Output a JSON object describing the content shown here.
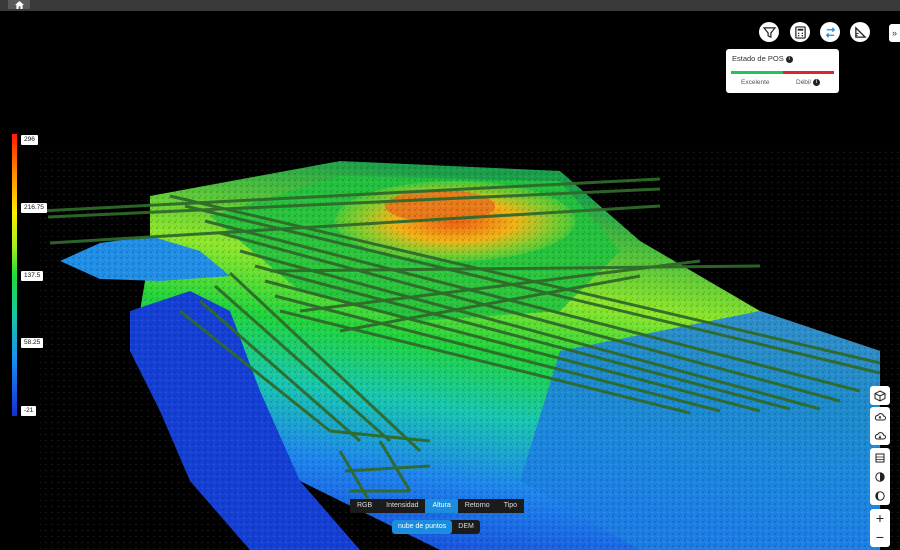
{
  "toolbar_icons": [
    "filter-icon",
    "calculator-icon",
    "swap-icon",
    "measure-icon"
  ],
  "expand_label": "»",
  "pos_panel": {
    "title": "Estado de POS",
    "info": "i",
    "label_good": "Excelente",
    "label_weak": "Débil",
    "colors": {
      "good": "#21c45a",
      "weak": "#e0242f"
    }
  },
  "legend": {
    "ticks": [
      "296",
      "216.75",
      "137.5",
      "58.25",
      "-21"
    ]
  },
  "right_controls": {
    "zoom_in": "+",
    "zoom_out": "−"
  },
  "attribute_tabs": [
    {
      "label": "RGB",
      "active": false
    },
    {
      "label": "Intensidad",
      "active": false
    },
    {
      "label": "Altura",
      "active": true
    },
    {
      "label": "Retorno",
      "active": false
    },
    {
      "label": "Tipo",
      "active": false
    }
  ],
  "view_modes": [
    {
      "label": "nube de puntos",
      "active": true
    },
    {
      "label": "DEM",
      "active": false
    }
  ],
  "accent_color": "#1b8de0"
}
